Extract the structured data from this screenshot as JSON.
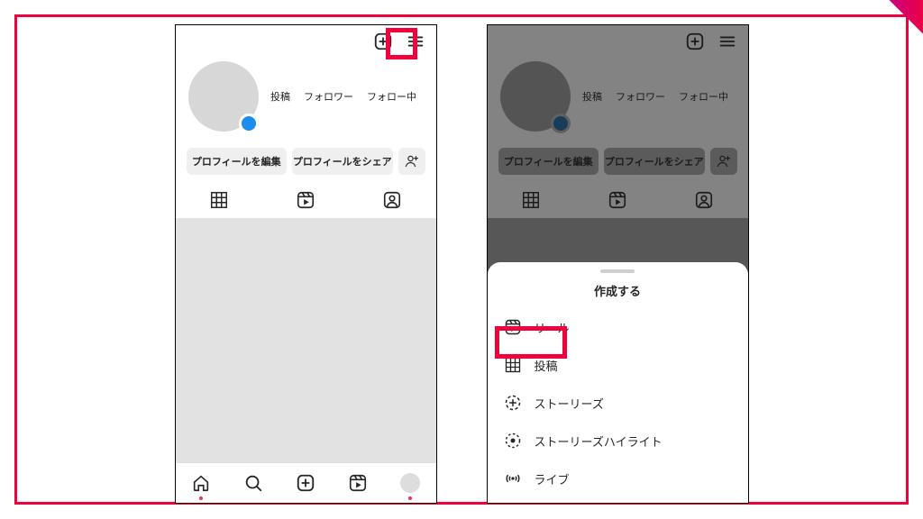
{
  "profile": {
    "stats": {
      "posts": "投稿",
      "followers": "フォロワー",
      "following": "フォロー中"
    },
    "buttons": {
      "edit": "プロフィールを編集",
      "share": "プロフィールをシェア",
      "add_friend_glyph": "+옷"
    }
  },
  "sheet": {
    "title": "作成する",
    "items": [
      {
        "key": "reel",
        "label": "リール"
      },
      {
        "key": "post",
        "label": "投稿"
      },
      {
        "key": "story",
        "label": "ストーリーズ"
      },
      {
        "key": "highlight",
        "label": "ストーリーズハイライト"
      },
      {
        "key": "live",
        "label": "ライブ"
      }
    ]
  },
  "icons": {
    "create": "create-icon",
    "menu": "menu-icon",
    "grid": "grid-icon",
    "reels": "reels-icon",
    "tagged": "tagged-icon",
    "home": "home-icon",
    "search": "search-icon",
    "add_friend": "add-friend-icon",
    "story_plus": "story-plus-icon",
    "highlight": "highlight-icon",
    "live": "live-icon"
  },
  "highlight_targets": {
    "create_button": true,
    "sheet_reel": true
  },
  "colors": {
    "accent": "#f2003c",
    "badge": "#1c8def"
  }
}
